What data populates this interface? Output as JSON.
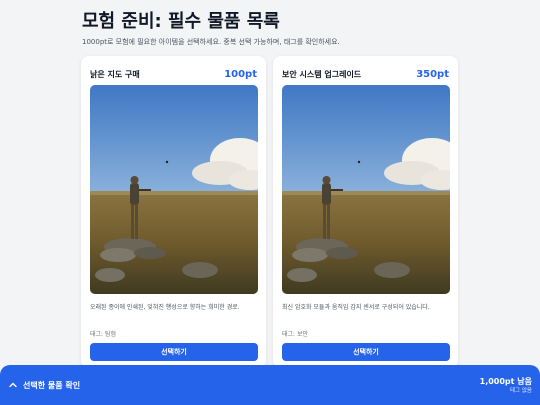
{
  "header": {
    "title": "모험 준비: 필수 물품 목록",
    "subtitle": "1000pt로 모험에 필요한 아이템을 선택하세요. 중복 선택 가능하며, 태그를 확인하세요."
  },
  "items": [
    {
      "title": "낡은 지도 구매",
      "price": "100pt",
      "description": "오래된 종이에 인쇄된, 잊혀진 행성으로 향하는 희미한 경로.",
      "tag": "태그: 탐험",
      "button_label": "선택하기"
    },
    {
      "title": "보안 시스템 업그레이드",
      "price": "350pt",
      "description": "최신 암호화 모듈과 움직임 감지 센서로 구성되어 있습니다.",
      "tag": "태그: 보안",
      "button_label": "선택하기"
    }
  ],
  "bottom_bar": {
    "label": "선택한 물품 확인",
    "points_left": "1,000pt 남음",
    "tags_status": "태그 없음"
  },
  "colors": {
    "accent": "#2563eb",
    "background": "#f3f4f6"
  }
}
